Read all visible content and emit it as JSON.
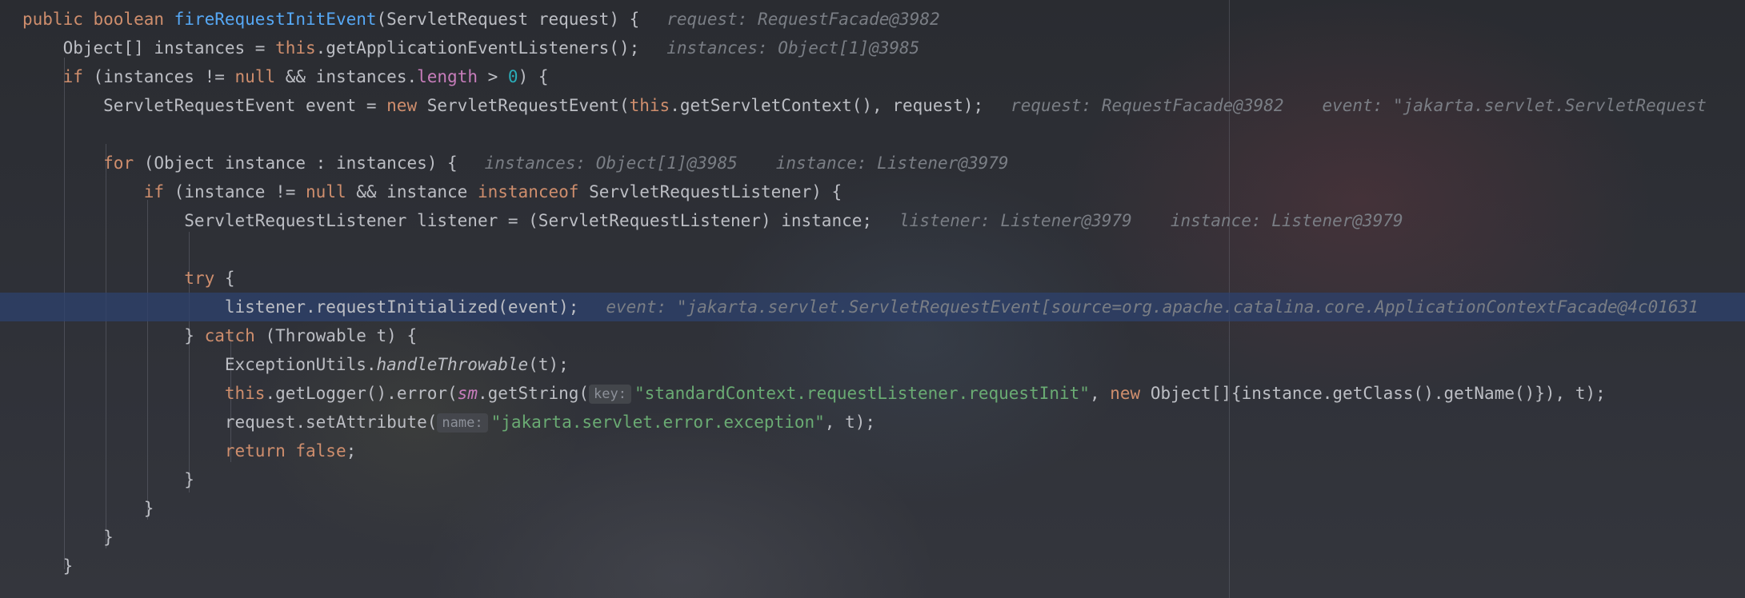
{
  "editor": {
    "lines": [
      {
        "parts": [
          {
            "t": "public boolean ",
            "c": "kw"
          },
          {
            "t": "fireRequestInitEvent",
            "c": "fn"
          },
          {
            "t": "(ServletRequest request) {",
            "c": ""
          }
        ],
        "hints": [
          "request: RequestFacade@3982"
        ]
      },
      {
        "parts": [
          {
            "t": "    Object[] instances = ",
            "c": ""
          },
          {
            "t": "this",
            "c": "kw"
          },
          {
            "t": ".getApplicationEventListeners();",
            "c": ""
          }
        ],
        "hints": [
          "instances: Object[1]@3985"
        ]
      },
      {
        "parts": [
          {
            "t": "    ",
            "c": ""
          },
          {
            "t": "if",
            "c": "kw"
          },
          {
            "t": " (instances != ",
            "c": ""
          },
          {
            "t": "null",
            "c": "kw"
          },
          {
            "t": " && instances.",
            "c": ""
          },
          {
            "t": "length",
            "c": "fld"
          },
          {
            "t": " > ",
            "c": ""
          },
          {
            "t": "0",
            "c": "num"
          },
          {
            "t": ") {",
            "c": ""
          }
        ],
        "hints": []
      },
      {
        "parts": [
          {
            "t": "        ServletRequestEvent event = ",
            "c": ""
          },
          {
            "t": "new",
            "c": "kw"
          },
          {
            "t": " ServletRequestEvent(",
            "c": ""
          },
          {
            "t": "this",
            "c": "kw"
          },
          {
            "t": ".getServletContext(), request);",
            "c": ""
          }
        ],
        "hints": [
          "request: RequestFacade@3982",
          "event: \"jakarta.servlet.ServletRequest"
        ]
      },
      {
        "parts": [],
        "hints": []
      },
      {
        "parts": [
          {
            "t": "        ",
            "c": ""
          },
          {
            "t": "for",
            "c": "kw"
          },
          {
            "t": " (Object instance : instances) {",
            "c": ""
          }
        ],
        "hints": [
          "instances: Object[1]@3985",
          "instance: Listener@3979"
        ]
      },
      {
        "parts": [
          {
            "t": "            ",
            "c": ""
          },
          {
            "t": "if",
            "c": "kw"
          },
          {
            "t": " (instance != ",
            "c": ""
          },
          {
            "t": "null",
            "c": "kw"
          },
          {
            "t": " && instance ",
            "c": ""
          },
          {
            "t": "instanceof",
            "c": "kw"
          },
          {
            "t": " ServletRequestListener) {",
            "c": ""
          }
        ],
        "hints": []
      },
      {
        "parts": [
          {
            "t": "                ServletRequestListener listener = (ServletRequestListener) instance;",
            "c": ""
          }
        ],
        "hints": [
          "listener: Listener@3979",
          "instance: Listener@3979"
        ]
      },
      {
        "parts": [],
        "hints": []
      },
      {
        "parts": [
          {
            "t": "                ",
            "c": ""
          },
          {
            "t": "try",
            "c": "kw"
          },
          {
            "t": " {",
            "c": ""
          }
        ],
        "hints": []
      },
      {
        "current": true,
        "parts": [
          {
            "t": "                    listener.requestInitialized(event);",
            "c": ""
          }
        ],
        "hints": [
          "event: \"jakarta.servlet.ServletRequestEvent[source=org.apache.catalina.core.ApplicationContextFacade@4c01631"
        ]
      },
      {
        "parts": [
          {
            "t": "                } ",
            "c": ""
          },
          {
            "t": "catch",
            "c": "kw"
          },
          {
            "t": " (Throwable t) {",
            "c": ""
          }
        ],
        "hints": []
      },
      {
        "parts": [
          {
            "t": "                    ExceptionUtils.",
            "c": ""
          },
          {
            "t": "handleThrowable",
            "c": "it"
          },
          {
            "t": "(t);",
            "c": ""
          }
        ],
        "hints": []
      },
      {
        "parts": [
          {
            "t": "                    ",
            "c": ""
          },
          {
            "t": "this",
            "c": "kw"
          },
          {
            "t": ".getLogger().error(",
            "c": ""
          },
          {
            "t": "sm",
            "c": "fld it"
          },
          {
            "t": ".getString(",
            "c": ""
          },
          {
            "p": "key:"
          },
          {
            "t": "\"standardContext.requestListener.requestInit\"",
            "c": "str"
          },
          {
            "t": ", ",
            "c": ""
          },
          {
            "t": "new",
            "c": "kw"
          },
          {
            "t": " Object[]{instance.getClass().getName()}), t);",
            "c": ""
          }
        ],
        "hints": []
      },
      {
        "parts": [
          {
            "t": "                    request.setAttribute(",
            "c": ""
          },
          {
            "p": "name:"
          },
          {
            "t": "\"jakarta.servlet.error.exception\"",
            "c": "str"
          },
          {
            "t": ", t);",
            "c": ""
          }
        ],
        "hints": []
      },
      {
        "parts": [
          {
            "t": "                    ",
            "c": ""
          },
          {
            "t": "return false",
            "c": "kw"
          },
          {
            "t": ";",
            "c": ""
          }
        ],
        "hints": []
      },
      {
        "parts": [
          {
            "t": "                }",
            "c": ""
          }
        ],
        "hints": []
      },
      {
        "parts": [
          {
            "t": "            }",
            "c": ""
          }
        ],
        "hints": []
      },
      {
        "parts": [
          {
            "t": "        }",
            "c": ""
          }
        ],
        "hints": []
      },
      {
        "parts": [
          {
            "t": "    }",
            "c": ""
          }
        ],
        "hints": []
      }
    ]
  }
}
